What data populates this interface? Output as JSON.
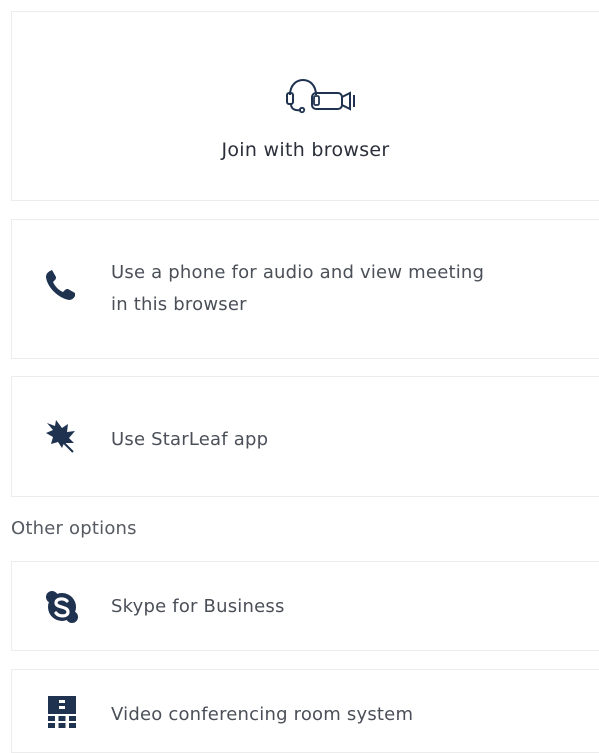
{
  "options": {
    "browser": {
      "label": "Join with browser",
      "icon": "headset-camera-icon"
    },
    "phone": {
      "label_line1": "Use a phone for audio and view meeting",
      "label_line2": "in this browser",
      "icon": "phone-icon"
    },
    "app": {
      "label": "Use StarLeaf app",
      "icon": "starleaf-icon"
    }
  },
  "other_options": {
    "heading": "Other options",
    "skype": {
      "label": "Skype for Business",
      "icon": "skype-icon"
    },
    "video_room": {
      "label": "Video conferencing room system",
      "icon": "room-system-icon"
    }
  },
  "colors": {
    "icon": "#1f3350",
    "text": "#4a4f58",
    "border": "#ececec"
  }
}
